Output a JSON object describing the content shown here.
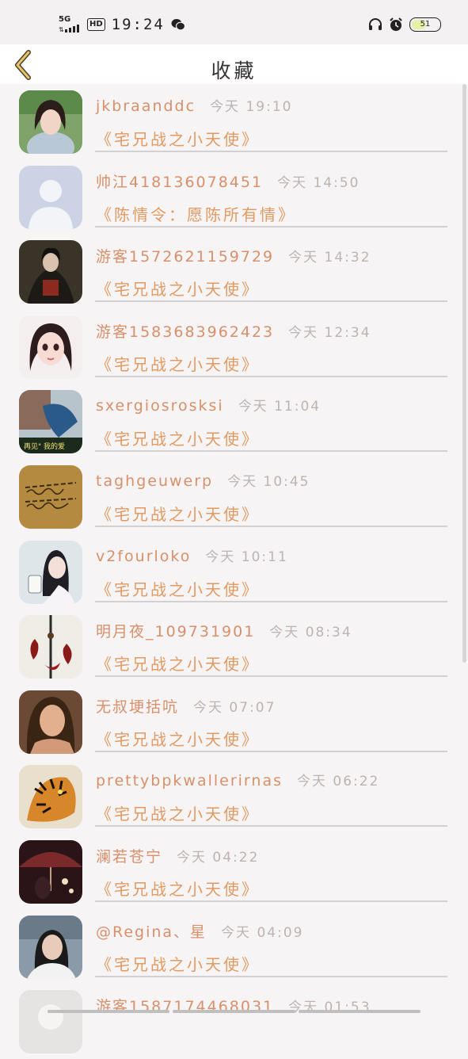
{
  "status_bar": {
    "network": "5G",
    "hd": "HD",
    "time": "19:24",
    "battery_level": "51",
    "icons": [
      "signal-icon",
      "wechat-icon",
      "headphones-icon",
      "alarm-icon",
      "battery-icon"
    ]
  },
  "header": {
    "title": "收藏",
    "back_icon": "chevron-left-icon"
  },
  "colors": {
    "username": "#d9906a",
    "time": "#bdb3b0",
    "novel_title": "#e29a62",
    "back_arrow": "#e8c468"
  },
  "favorites": [
    {
      "username": "jkbraanddc",
      "time": "今天 19:10",
      "novel": "《宅兄战之小天使》",
      "avatar": "girl-portrait-avatar"
    },
    {
      "username": "帅江4181360784​51",
      "time": "今天 14:50",
      "novel": "《陈情令：愿陈所有情》",
      "avatar": "default-avatar"
    },
    {
      "username": "游客1572621159729",
      "time": "今天 14:32",
      "novel": "《宅兄战之小天使》",
      "avatar": "ancient-costume-avatar"
    },
    {
      "username": "游客1583683962423",
      "time": "今天 12:34",
      "novel": "《宅兄战之小天使》",
      "avatar": "doll-avatar"
    },
    {
      "username": "sxergiosrosksi",
      "time": "今天 11:04",
      "novel": "《宅兄战之小天使》",
      "avatar": "再见我的爱-avatar"
    },
    {
      "username": "taghgeuwerp",
      "time": "今天 10:45",
      "novel": "《宅兄战之小天使》",
      "avatar": "handwriting-avatar"
    },
    {
      "username": "v2fourloko",
      "time": "今天 10:11",
      "novel": "《宅兄战之小天使》",
      "avatar": "girl-lantern-avatar"
    },
    {
      "username": "明月夜_109731901",
      "time": "今天 08:34",
      "novel": "《宅兄战之小天使》",
      "avatar": "sword-avatar"
    },
    {
      "username": "无叔埂括吭",
      "time": "今天 07:07",
      "novel": "《宅兄战之小天使》",
      "avatar": "woman-portrait-avatar"
    },
    {
      "username": "prettybpkwallerirnas",
      "time": "今天 06:22",
      "novel": "《宅兄战之小天使》",
      "avatar": "tiger-avatar"
    },
    {
      "username": "澜若苍宁",
      "time": "今天 04:22",
      "novel": "《宅兄战之小天使》",
      "avatar": "umbrella-avatar"
    },
    {
      "username": "@Regina、星",
      "time": "今天 04:09",
      "novel": "《宅兄战之小天使》",
      "avatar": "selfie-avatar"
    },
    {
      "username": "游客1587174468031",
      "time": "今天 01:53",
      "novel": "",
      "avatar": "white-avatar"
    }
  ]
}
